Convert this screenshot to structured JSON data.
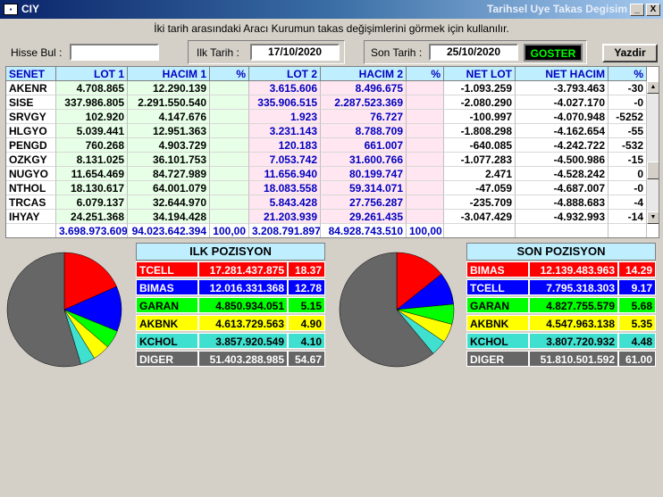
{
  "window": {
    "title_left": "CIY",
    "title_right": "Tarihsel Uye Takas Degisim",
    "minimize": "_",
    "close": "X"
  },
  "description": "İki tarih arasındaki  Aracı Kurumun takas değişimlerini görmek için kullanılır.",
  "filters": {
    "hisse_label": "Hisse Bul :",
    "hisse_value": "",
    "ilk_label": "Ilk Tarih :",
    "ilk_value": "17/10/2020",
    "son_label": "Son Tarih :",
    "son_value": "25/10/2020",
    "goster": "GOSTER",
    "yazdir": "Yazdir"
  },
  "table": {
    "headers": [
      "SENET",
      "LOT 1",
      "HACIM 1",
      "%",
      "LOT 2",
      "HACIM 2",
      "%",
      "NET LOT",
      "NET HACIM",
      "%"
    ],
    "rows": [
      [
        "AKENR",
        "4.708.865",
        "12.290.139",
        "",
        "3.615.606",
        "8.496.675",
        "",
        "-1.093.259",
        "-3.793.463",
        "-30"
      ],
      [
        "SISE",
        "337.986.805",
        "2.291.550.540",
        "",
        "335.906.515",
        "2.287.523.369",
        "",
        "-2.080.290",
        "-4.027.170",
        "-0"
      ],
      [
        "SRVGY",
        "102.920",
        "4.147.676",
        "",
        "1.923",
        "76.727",
        "",
        "-100.997",
        "-4.070.948",
        "-5252"
      ],
      [
        "HLGYO",
        "5.039.441",
        "12.951.363",
        "",
        "3.231.143",
        "8.788.709",
        "",
        "-1.808.298",
        "-4.162.654",
        "-55"
      ],
      [
        "PENGD",
        "760.268",
        "4.903.729",
        "",
        "120.183",
        "661.007",
        "",
        "-640.085",
        "-4.242.722",
        "-532"
      ],
      [
        "OZKGY",
        "8.131.025",
        "36.101.753",
        "",
        "7.053.742",
        "31.600.766",
        "",
        "-1.077.283",
        "-4.500.986",
        "-15"
      ],
      [
        "NUGYO",
        "11.654.469",
        "84.727.989",
        "",
        "11.656.940",
        "80.199.747",
        "",
        "2.471",
        "-4.528.242",
        "0"
      ],
      [
        "NTHOL",
        "18.130.617",
        "64.001.079",
        "",
        "18.083.558",
        "59.314.071",
        "",
        "-47.059",
        "-4.687.007",
        "-0"
      ],
      [
        "TRCAS",
        "6.079.137",
        "32.644.970",
        "",
        "5.843.428",
        "27.756.287",
        "",
        "-235.709",
        "-4.888.683",
        "-4"
      ],
      [
        "IHYAY",
        "24.251.368",
        "34.194.428",
        "",
        "21.203.939",
        "29.261.435",
        "",
        "-3.047.429",
        "-4.932.993",
        "-14"
      ]
    ],
    "totals": [
      "",
      "3.698.973.609",
      "94.023.642.394",
      "100,00",
      "3.208.791.897",
      "84.928.743.510",
      "100,00",
      "",
      "",
      ""
    ]
  },
  "ilk_pozisyon": {
    "title": "ILK POZISYON",
    "rows": [
      {
        "name": "TCELL",
        "value": "17.281.437.875",
        "pct": "18.37",
        "share": 18.37,
        "color": "#ff0000",
        "text": "#ffffff"
      },
      {
        "name": "BIMAS",
        "value": "12.016.331.368",
        "pct": "12.78",
        "share": 12.78,
        "color": "#0000ff",
        "text": "#ffffff"
      },
      {
        "name": "GARAN",
        "value": "4.850.934.051",
        "pct": "5.15",
        "share": 5.15,
        "color": "#00ff00",
        "text": "#000000"
      },
      {
        "name": "AKBNK",
        "value": "4.613.729.563",
        "pct": "4.90",
        "share": 4.9,
        "color": "#ffff00",
        "text": "#000000"
      },
      {
        "name": "KCHOL",
        "value": "3.857.920.549",
        "pct": "4.10",
        "share": 4.1,
        "color": "#40e0d0",
        "text": "#000000"
      },
      {
        "name": "DIGER",
        "value": "51.403.288.985",
        "pct": "54.67",
        "share": 54.67,
        "color": "#666666",
        "text": "#ffffff"
      }
    ]
  },
  "son_pozisyon": {
    "title": "SON POZISYON",
    "rows": [
      {
        "name": "BIMAS",
        "value": "12.139.483.963",
        "pct": "14.29",
        "share": 14.29,
        "color": "#ff0000",
        "text": "#ffffff"
      },
      {
        "name": "TCELL",
        "value": "7.795.318.303",
        "pct": "9.17",
        "share": 9.17,
        "color": "#0000ff",
        "text": "#ffffff"
      },
      {
        "name": "GARAN",
        "value": "4.827.755.579",
        "pct": "5.68",
        "share": 5.68,
        "color": "#00ff00",
        "text": "#000000"
      },
      {
        "name": "AKBNK",
        "value": "4.547.963.138",
        "pct": "5.35",
        "share": 5.35,
        "color": "#ffff00",
        "text": "#000000"
      },
      {
        "name": "KCHOL",
        "value": "3.807.720.932",
        "pct": "4.48",
        "share": 4.48,
        "color": "#40e0d0",
        "text": "#000000"
      },
      {
        "name": "DIGER",
        "value": "51.810.501.592",
        "pct": "61.00",
        "share": 61.0,
        "color": "#666666",
        "text": "#ffffff"
      }
    ]
  }
}
